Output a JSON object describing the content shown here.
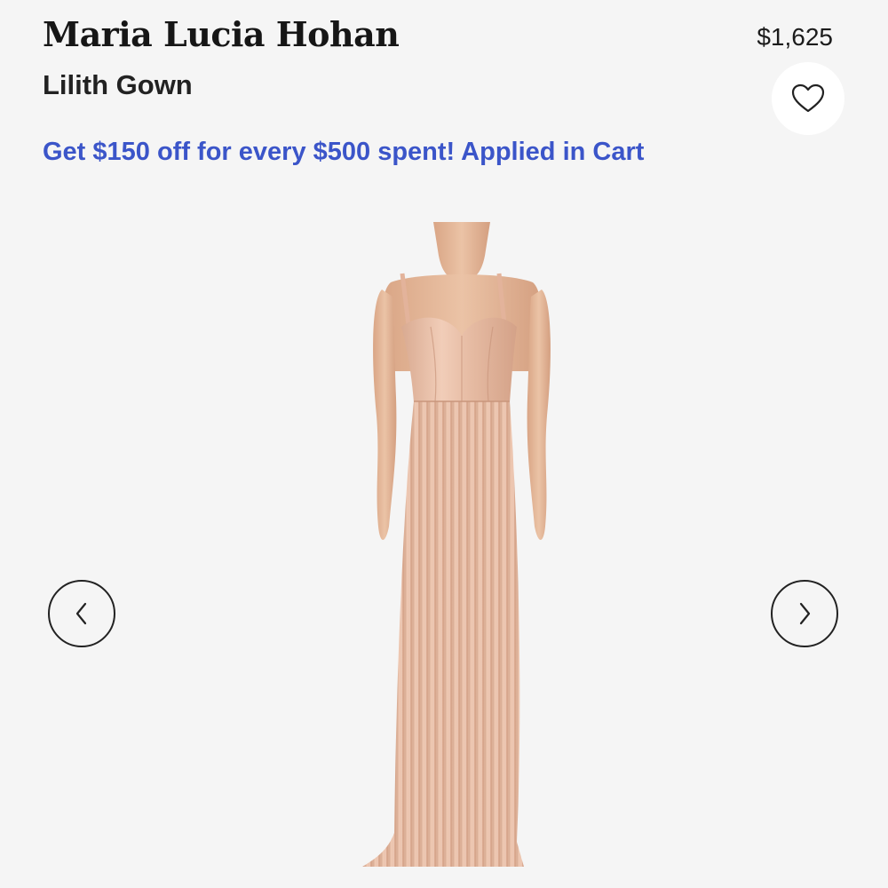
{
  "product": {
    "brand": "Maria Lucia Hohan",
    "name": "Lilith Gown",
    "price": "$1,625"
  },
  "promo": {
    "text": "Get $150 off for every $500 spent! Applied in Cart",
    "color": "#3b55c9"
  },
  "favorite": {
    "icon": "heart-outline-icon"
  },
  "carousel": {
    "prev_icon": "chevron-left-icon",
    "next_icon": "chevron-right-icon"
  },
  "colors": {
    "background": "#f5f5f5",
    "gown": "#e3b8a0",
    "text": "#161616"
  }
}
